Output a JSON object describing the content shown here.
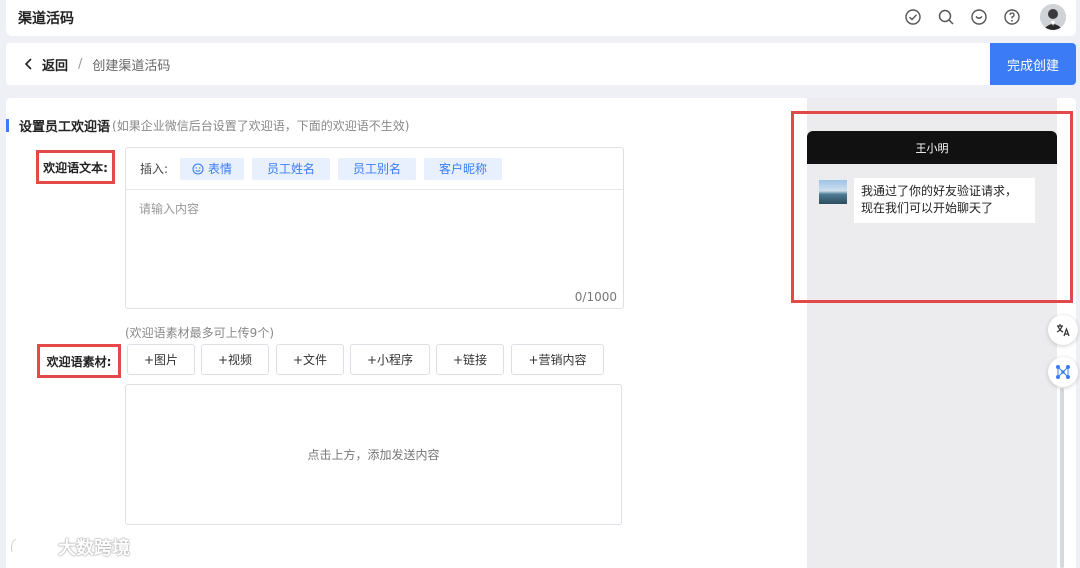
{
  "topbar": {
    "title": "渠道活码"
  },
  "breadcrumb": {
    "back": "返回",
    "separator": "/",
    "current": "创建渠道活码",
    "finish_button": "完成创建"
  },
  "section": {
    "title": "设置员工欢迎语",
    "note": "(如果企业微信后台设置了欢迎语，下面的欢迎语不生效)"
  },
  "welcome_text": {
    "label": "欢迎语文本:",
    "insert_label": "插入:",
    "chips": [
      "表情",
      "员工姓名",
      "员工别名",
      "客户昵称"
    ],
    "placeholder": "请输入内容",
    "counter": "0/1000"
  },
  "welcome_material": {
    "note": "(欢迎语素材最多可上传9个)",
    "label": "欢迎语素材:",
    "buttons": [
      "+图片",
      "+视频",
      "+文件",
      "+小程序",
      "+链接",
      "+营销内容"
    ],
    "drop_hint": "点击上方，添加发送内容"
  },
  "preview": {
    "contact_name": "王小明",
    "message_line1": "我通过了你的好友验证请求，",
    "message_line2": "现在我们可以开始聊天了"
  },
  "brand": {
    "name": "大数跨境"
  },
  "colors": {
    "accent": "#3b7cf6",
    "highlight_red": "#e24a4a"
  }
}
